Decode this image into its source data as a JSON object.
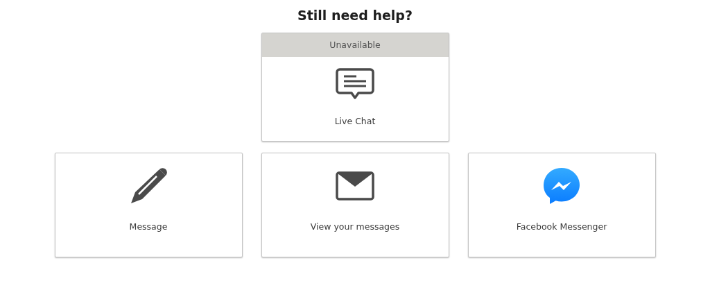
{
  "heading": "Still need help?",
  "rows": [
    {
      "options": [
        {
          "label": "Live Chat",
          "kind": "chat",
          "status": "Unavailable"
        }
      ]
    },
    {
      "options": [
        {
          "label": "Message",
          "kind": "pencil"
        },
        {
          "label": "View your messages",
          "kind": "envelope"
        },
        {
          "label": "Facebook Messenger",
          "kind": "messenger"
        }
      ]
    }
  ]
}
